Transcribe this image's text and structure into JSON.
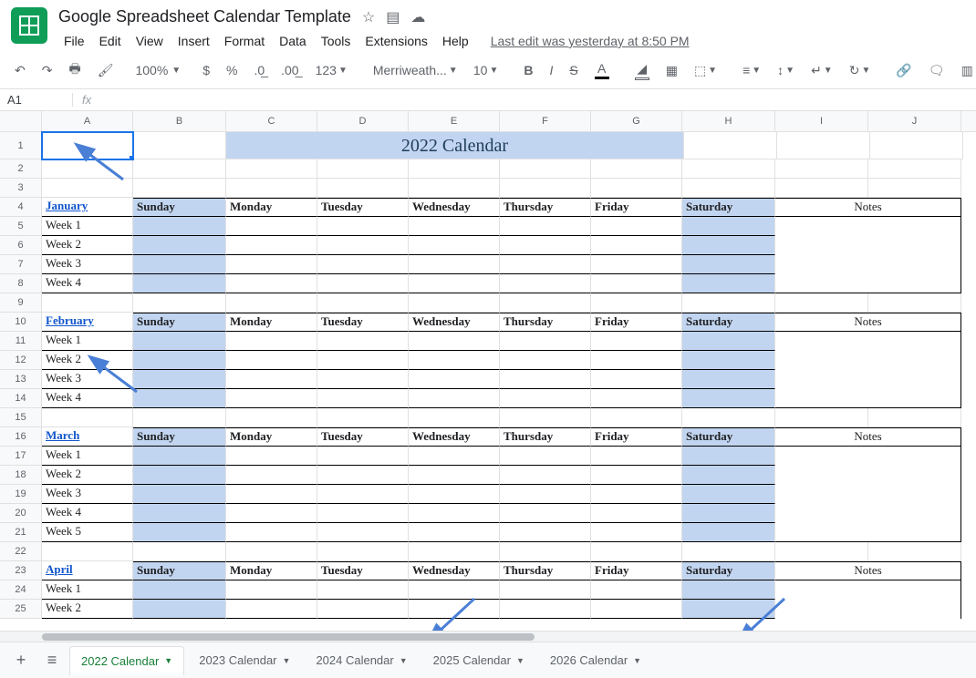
{
  "doc": {
    "title": "Google Spreadsheet Calendar Template"
  },
  "menu": {
    "file": "File",
    "edit": "Edit",
    "view": "View",
    "insert": "Insert",
    "format": "Format",
    "data": "Data",
    "tools": "Tools",
    "extensions": "Extensions",
    "help": "Help",
    "last_edit": "Last edit was yesterday at 8:50 PM"
  },
  "toolbar": {
    "zoom": "100%",
    "font": "Merriweath...",
    "size": "10"
  },
  "namebox": "A1",
  "columns": [
    "A",
    "B",
    "C",
    "D",
    "E",
    "F",
    "G",
    "H",
    "I",
    "J"
  ],
  "title_cell": "2022 Calendar",
  "days": {
    "sun": "Sunday",
    "mon": "Monday",
    "tue": "Tuesday",
    "wed": "Wednesday",
    "thu": "Thursday",
    "fri": "Friday",
    "sat": "Saturday",
    "notes": "Notes"
  },
  "months": {
    "jan": {
      "name": "January",
      "weeks": [
        "Week 1",
        "Week 2",
        "Week 3",
        "Week 4"
      ]
    },
    "feb": {
      "name": "February",
      "weeks": [
        "Week 1",
        "Week 2",
        "Week 3",
        "Week 4"
      ]
    },
    "mar": {
      "name": "March",
      "weeks": [
        "Week 1",
        "Week 2",
        "Week 3",
        "Week 4",
        "Week 5"
      ]
    },
    "apr": {
      "name": "April",
      "weeks": [
        "Week 1",
        "Week 2"
      ]
    }
  },
  "sheets": {
    "active": "2022 Calendar",
    "others": [
      "2023 Calendar",
      "2024 Calendar",
      "2025 Calendar",
      "2026 Calendar"
    ]
  }
}
